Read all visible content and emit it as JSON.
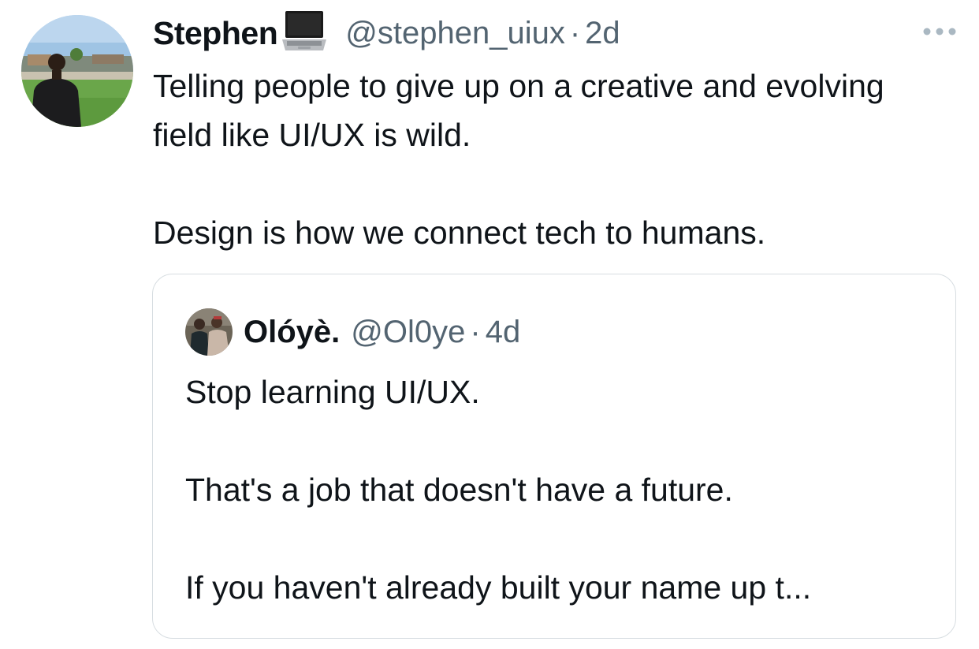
{
  "tweet": {
    "author": {
      "name": "Stephen",
      "handle": "@stephen_uiux",
      "badge_icon": "laptop-icon"
    },
    "separator": "·",
    "time": "2d",
    "more_icon": "more-horizontal-icon",
    "text": {
      "line1": "Telling people to give up on a creative and evolving field like UI/UX is wild.",
      "line2": "Design is how we connect tech to humans."
    }
  },
  "quote": {
    "author": {
      "name": "Olóyè.",
      "handle": "@Ol0ye"
    },
    "separator": "·",
    "time": "4d",
    "text": {
      "line1": "Stop learning UI/UX.",
      "line2": "That's a job that doesn't have a future.",
      "line3": "If you haven't already built your name up t..."
    }
  },
  "colors": {
    "primary_text": "#0f1419",
    "secondary_text": "#536471",
    "border": "#d7dde1",
    "background": "#ffffff"
  }
}
